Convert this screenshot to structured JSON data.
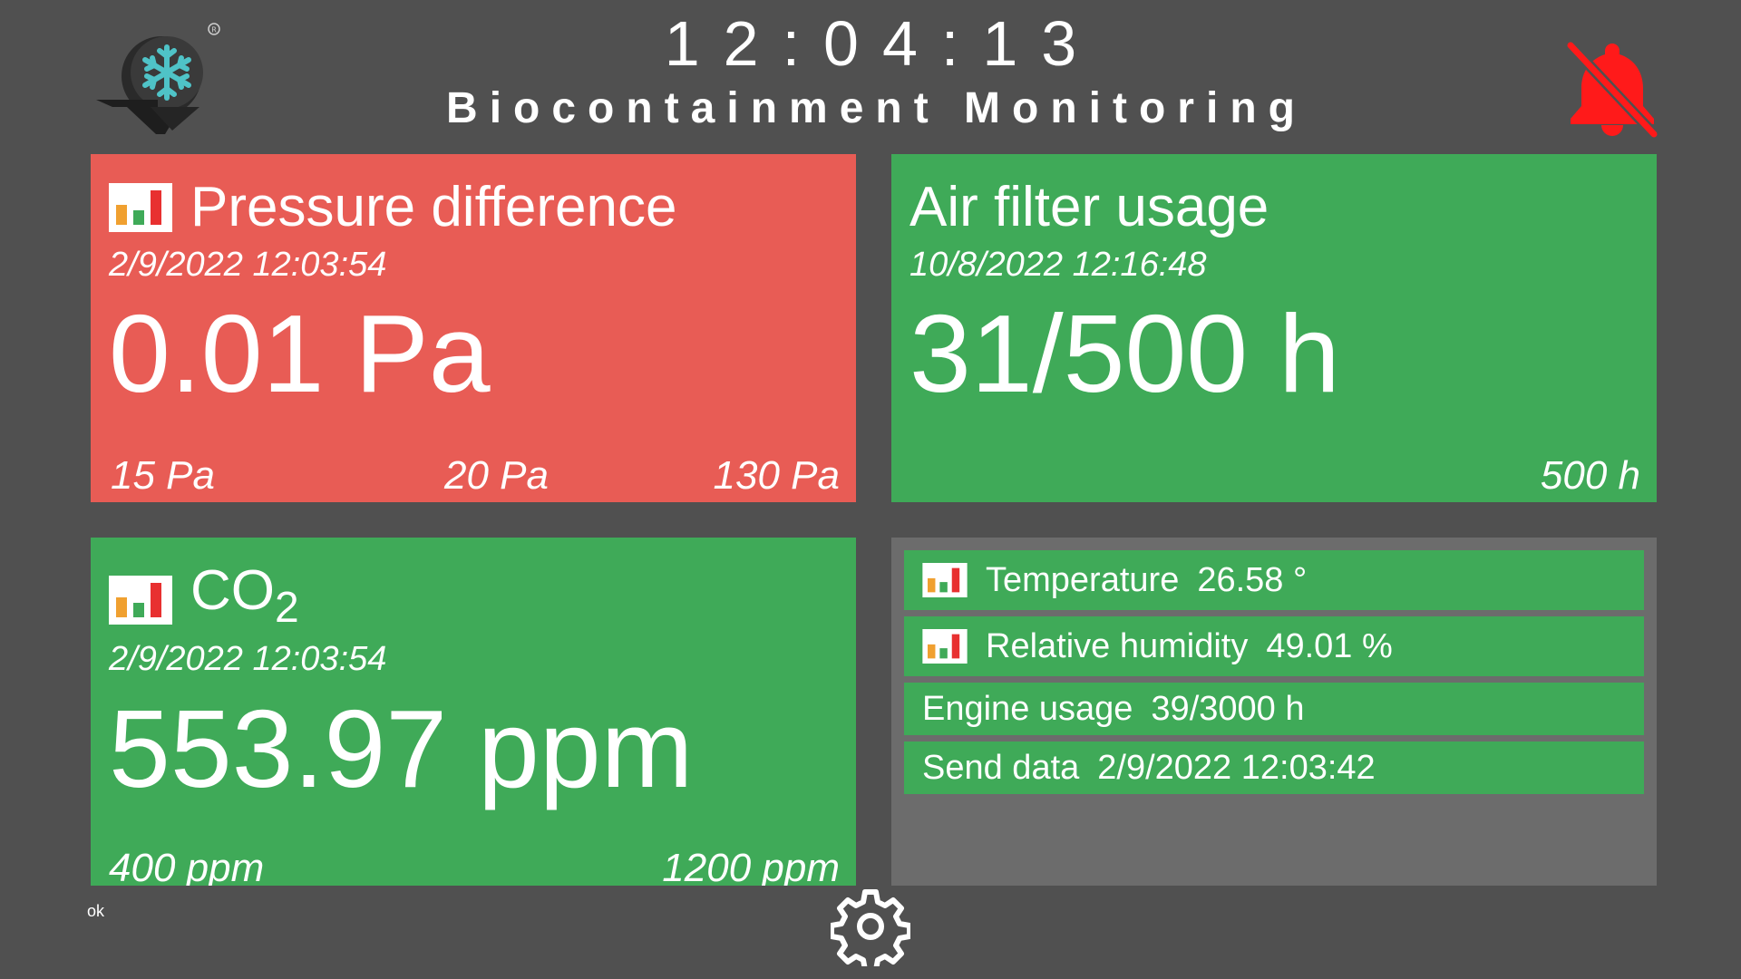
{
  "header": {
    "clock": "12:04:13",
    "title": "Biocontainment Monitoring",
    "logo_icon": "snowflake-logo-icon",
    "alarm_icon": "bell-muted-icon",
    "alarm_color": "#ff1a1a"
  },
  "cards": {
    "pressure": {
      "title": "Pressure difference",
      "timestamp": "2/9/2022 12:03:54",
      "value": "0.01 Pa",
      "thresholds": [
        "15 Pa",
        "20 Pa",
        "130 Pa"
      ],
      "color": "#e85c55"
    },
    "filter": {
      "title": "Air filter usage",
      "timestamp": "10/8/2022 12:16:48",
      "value": "31/500 h",
      "threshold": "500 h",
      "color": "#3faa58"
    },
    "co2": {
      "title_main": "CO",
      "title_sub": "2",
      "timestamp": "2/9/2022 12:03:54",
      "value": "553.97 ppm",
      "thresholds": [
        "400 ppm",
        "1200 ppm"
      ],
      "color": "#3faa58"
    }
  },
  "info_panel": {
    "rows": [
      {
        "label": "Temperature",
        "value": "26.58 °"
      },
      {
        "label": "Relative humidity",
        "value": "49.01 %"
      },
      {
        "label": "Engine usage",
        "value": "39/3000 h"
      },
      {
        "label": "Send data",
        "value": "2/9/2022 12:03:42"
      }
    ]
  },
  "footer": {
    "status": "ok",
    "settings_icon": "gear-icon"
  },
  "colors": {
    "background": "#505050",
    "alarm_red": "#e85c55",
    "ok_green": "#3faa58",
    "panel_gray": "#6c6c6c"
  }
}
